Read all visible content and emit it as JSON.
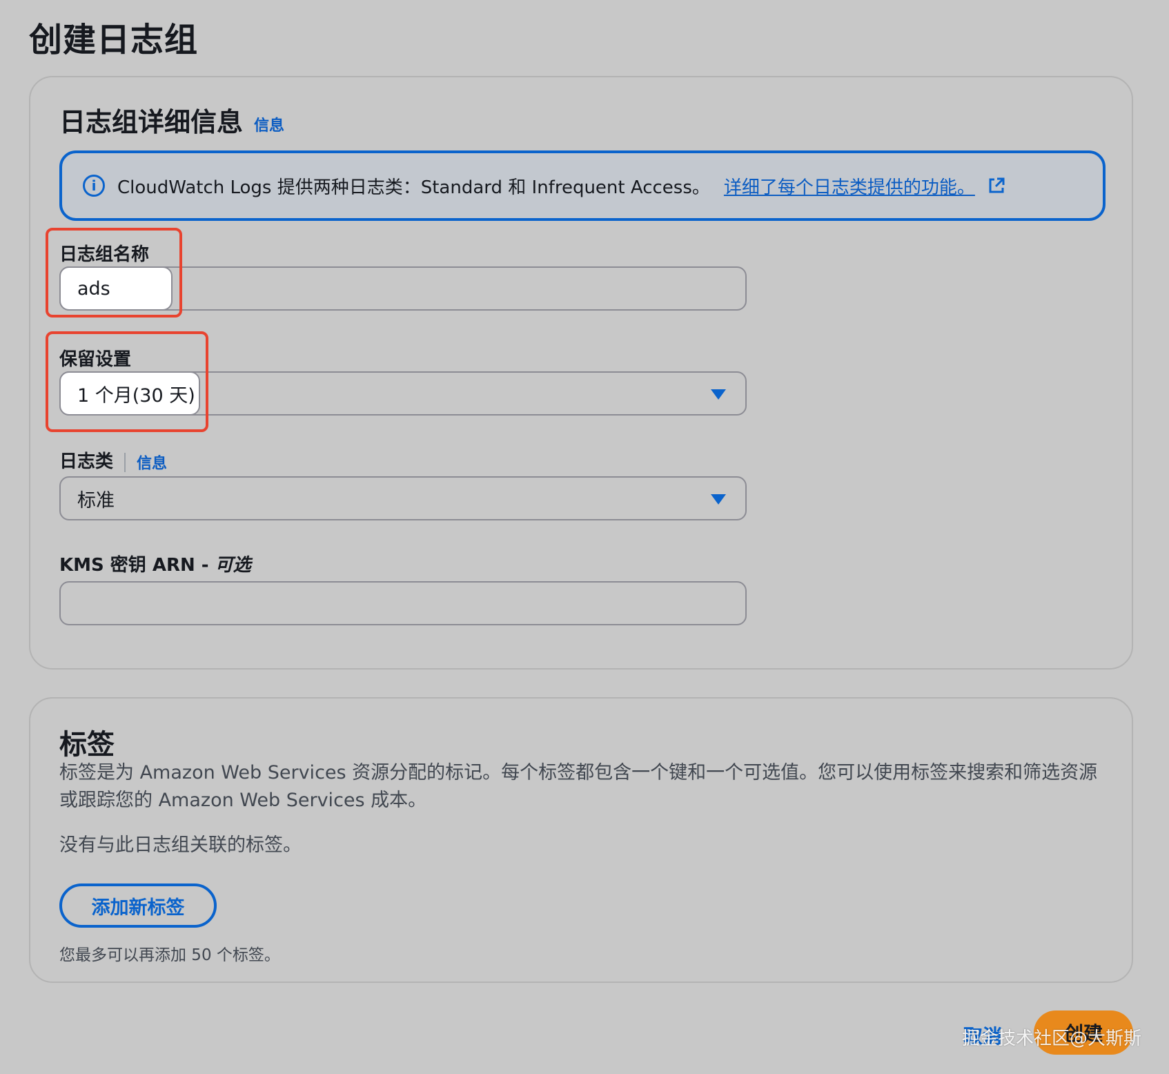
{
  "page": {
    "title": "创建日志组"
  },
  "details": {
    "title": "日志组详细信息",
    "info_link": "信息",
    "alert": {
      "text": "CloudWatch Logs 提供两种日志类：Standard 和 Infrequent Access。",
      "link": "详细了每个日志类提供的功能。",
      "icon": "info-circle-icon",
      "link_icon": "external-link-icon"
    },
    "name_field": {
      "label": "日志组名称",
      "value": "ads"
    },
    "retention_field": {
      "label": "保留设置",
      "value": "1 个月(30 天)"
    },
    "class_field": {
      "label": "日志类",
      "info_link": "信息",
      "value": "标准"
    },
    "kms_field": {
      "label": "KMS 密钥 ARN - ",
      "optional": "可选",
      "value": ""
    }
  },
  "tags": {
    "title": "标签",
    "description": "标签是为 Amazon Web Services 资源分配的标记。每个标签都包含一个键和一个可选值。您可以使用标签来搜索和筛选资源或跟踪您的 Amazon Web Services 成本。",
    "empty_text": "没有与此日志组关联的标签。",
    "add_button": "添加新标签",
    "limit_text": "您最多可以再添加 50 个标签。"
  },
  "footer": {
    "cancel": "取消",
    "create": "创建",
    "watermark": "掘金技术社区@大斯斯"
  },
  "colors": {
    "accent": "#0a63cc",
    "primary_button": "#e8891c",
    "highlight": "#e8432f",
    "background": "#c8c8c8"
  }
}
